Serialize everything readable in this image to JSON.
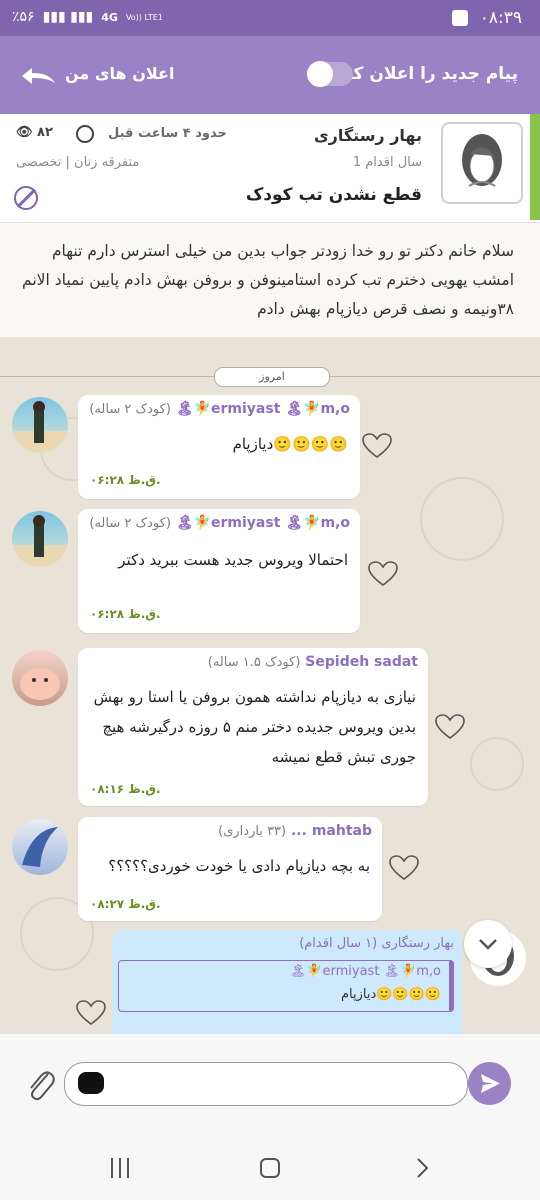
{
  "status_bar": {
    "time": "۰۸:۳۹",
    "battery": "٪۵۶",
    "network": "4G",
    "network_sub": "Vo)) LTE1"
  },
  "header": {
    "notify_label": "پیام جدید را اعلان کن",
    "my_notifications_label": "اعلان های من",
    "toggle_on": false
  },
  "post": {
    "author": "بهار رستگاری",
    "author_sub": "1 سال اقدام",
    "title": "قطع نشدن تب کودک",
    "time_label": "حدود ۴ ساعت قبل",
    "views": "۸۲",
    "category": "متفرقه زنان | تخصصی",
    "body": "سلام خانم دکتر تو رو خدا زودتر جواب بدین من خیلی استرس دارم تنهام امشب یهویی دخترم تب کرده استامینوفن و بروفن بهش دادم پایین نمیاد الانم ۳۸ونیمه و نصف قرص دیازپام بهش دادم"
  },
  "chat": {
    "today_label": "امروز",
    "messages": [
      {
        "name": "ermiyast 🏝🧚m,o🧚🏝",
        "age": "(کودک ۲ ساله)",
        "text": "🙂🙂🙂🙂دیازپام",
        "time": "۰۶:۲۸ ق.ظ."
      },
      {
        "name": "ermiyast 🏝🧚m,o🧚🏝",
        "age": "(کودک ۲ ساله)",
        "text": "احتمالا ویروس جدید هست ببرید دکتر",
        "time": "۰۶:۲۸ ق.ظ."
      },
      {
        "name": "Sepideh sadat",
        "age": "(کودک ۱.۵ ساله)",
        "text": "نیازی به دیازپام نداشته همون بروفن یا استا رو بهش بدین ویروس جدیده دختر منم ۵ روزه درگیرشه هیچ جوری تبش قطع نمیشه",
        "time": "۰۸:۱۶ ق.ظ."
      },
      {
        "name": "mahtab ...",
        "age": "(۳۳ بارداری)",
        "text": "به بچه دیازپام دادی یا خودت خوردی؟؟؟؟؟",
        "time": "۰۸:۲۷ ق.ظ."
      }
    ],
    "my_reply": {
      "name": "بهار رستگاری (۱ سال اقدام)",
      "quote_name": "ermiyast 🏝🧚m,o🧚🏝",
      "quote_text": "🙂🙂🙂🙂دیازپام"
    }
  },
  "composer": {
    "placeholder": ""
  },
  "colors": {
    "primary": "#9982c6",
    "primary_dark": "#7e65ad",
    "accent_green": "#8bc34a",
    "time_green": "#6b8e23"
  }
}
